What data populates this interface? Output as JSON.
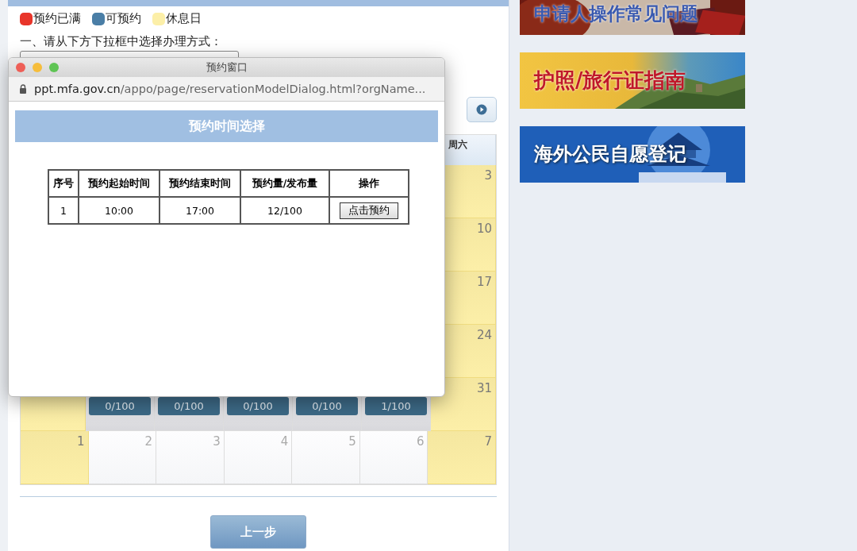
{
  "legend": [
    {
      "label": "预约已满",
      "color": "#e8352a"
    },
    {
      "label": "可预约",
      "color": "#4a7ea6"
    },
    {
      "label": "休息日",
      "color": "#fcefa8"
    }
  ],
  "step_label": "一、请从下方下拉框中选择办理方式：",
  "calendar": {
    "weekday_headers": [
      "周六"
    ],
    "weeks": [
      [
        {
          "kind": "rest",
          "day": "3"
        }
      ],
      [
        {
          "kind": "rest",
          "day": "10"
        }
      ],
      [
        {
          "kind": "rest",
          "day": "17"
        }
      ],
      [
        {
          "kind": "rest",
          "day": "24"
        }
      ],
      [
        {
          "kind": "rest"
        },
        {
          "kind": "open",
          "count": "0/100"
        },
        {
          "kind": "open",
          "count": "0/100"
        },
        {
          "kind": "open",
          "count": "0/100"
        },
        {
          "kind": "open",
          "count": "0/100"
        },
        {
          "kind": "open",
          "count": "1/100"
        },
        {
          "kind": "rest",
          "day": "31"
        }
      ],
      [
        {
          "kind": "rest",
          "day": "1"
        },
        {
          "kind": "empty",
          "day": "2"
        },
        {
          "kind": "empty",
          "day": "3"
        },
        {
          "kind": "empty",
          "day": "4"
        },
        {
          "kind": "empty",
          "day": "5"
        },
        {
          "kind": "empty",
          "day": "6"
        },
        {
          "kind": "rest",
          "day": "7"
        }
      ]
    ]
  },
  "prev_button": "上一步",
  "banners": [
    {
      "text": "申请人操作常见问题",
      "kind": "passport"
    },
    {
      "text": "护照/旅行证指南",
      "kind": "wall"
    },
    {
      "text": "海外公民自愿登记",
      "kind": "temple"
    }
  ],
  "dialog": {
    "title": "预约窗口",
    "url_host": "ppt.mfa.gov.cn",
    "url_path": "/appo/page/reservationModelDialog.html?orgName...",
    "heading": "预约时间选择",
    "table": {
      "columns": [
        "序号",
        "预约起始时间",
        "预约结束时间",
        "预约量/发布量",
        "操作"
      ],
      "rows": [
        {
          "cells": [
            "1",
            "10:00",
            "17:00",
            "12/100"
          ],
          "action": "点击预约"
        }
      ]
    }
  }
}
